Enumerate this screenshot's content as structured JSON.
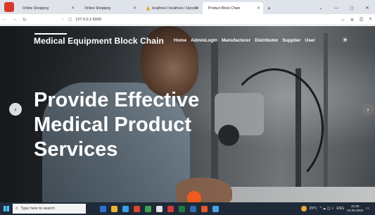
{
  "browser": {
    "tabs": [
      {
        "label": "Online Shopping",
        "active": false
      },
      {
        "label": "Online Shopping",
        "active": false
      },
      {
        "label": "localhost / localhost / 1qrcode",
        "active": false,
        "warning_icon": true
      },
      {
        "label": "Product Block Chain",
        "active": true
      }
    ],
    "new_tab": "+",
    "window_controls": [
      "⌄",
      "—",
      "▢",
      "✕"
    ],
    "url": "127.0.0.1:5000"
  },
  "site": {
    "brand": "Medical Equipment Block Chain",
    "nav": [
      "Home",
      "AdminLogin",
      "Manufacturer",
      "Distributor",
      "Supplier",
      "User"
    ],
    "headline": [
      "Provide Effective",
      "Medical Product",
      "Services"
    ]
  },
  "taskbar": {
    "search_placeholder": "Type here to search",
    "temperature": "29°C",
    "language": "ENG",
    "time": "21:08",
    "date": "04-06-2023",
    "app_colors": [
      "#2f6fd6",
      "#e8b23a",
      "#3ba0e6",
      "#d64a2b",
      "#3ca14f",
      "#e2e2e2",
      "#d23b3b",
      "#1e7a45",
      "#2b6cb0",
      "#e05a2a",
      "#4aa3df"
    ]
  },
  "colors": {
    "brand_accent": "#f05a22",
    "taskbar": "#1f2a38",
    "tabstrip": "#dfe3ea"
  }
}
